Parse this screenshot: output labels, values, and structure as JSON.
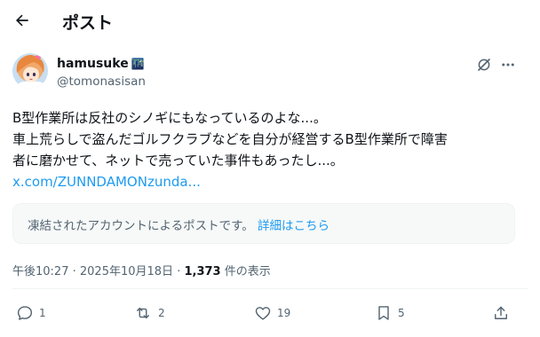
{
  "header": {
    "title": "ポスト",
    "back_icon": "arrow-left-icon"
  },
  "author": {
    "display_name": "hamusuke",
    "name_suffix": "🌃",
    "handle": "@tomonasisan",
    "avatar_icon": "avatar-anime-icon"
  },
  "tweet": {
    "lines": [
      "B型作業所は反社のシノギにもなっているのよな...。",
      "車上荒らしで盗んだゴルフクラブなどを自分が経営するB型作業所で障害",
      "者に磨かせて、ネットで売っていた事件もあったし...。"
    ],
    "link": "x.com/ZUNNDAMONzunda..."
  },
  "notice": {
    "text": "凍結されたアカウントによるポストです。",
    "link": "詳細はこちら"
  },
  "meta": {
    "time": "午後10:27",
    "separator": "·",
    "date": "2025年10月18日",
    "views_count": "1,373",
    "views_label": "件の表示"
  },
  "actions": {
    "reply_count": "1",
    "repost_count": "2",
    "like_count": "19",
    "bookmark_count": "5"
  },
  "colors": {
    "accent": "#1d9bf0",
    "text": "#0f1419",
    "muted": "#536471",
    "border": "#eff3f4"
  }
}
